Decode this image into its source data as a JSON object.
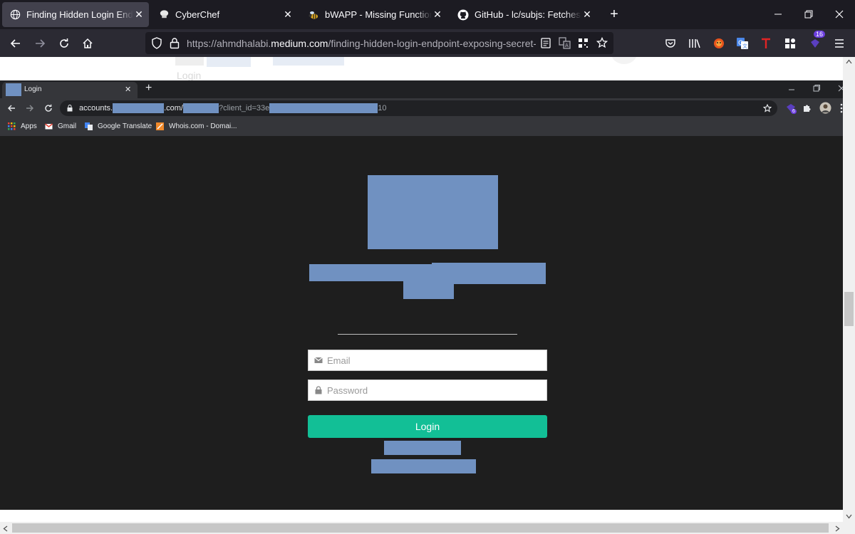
{
  "firefox": {
    "tabs": [
      {
        "title": "Finding Hidden Login Endpoint",
        "active": true,
        "icon": "globe-icon"
      },
      {
        "title": "CyberChef",
        "active": false,
        "icon": "chef-hat-icon"
      },
      {
        "title": "bWAPP - Missing Functional Lev",
        "active": false,
        "icon": "bee-icon"
      },
      {
        "title": "GitHub - lc/subjs: Fetches javasc",
        "active": false,
        "icon": "github-icon"
      }
    ],
    "new_tab": "+",
    "url": {
      "prefix": "https://ahmdhalabi.",
      "domain": "medium.com",
      "path": "/finding-hidden-login-endpoint-exposing-secret-clie"
    },
    "toolbar_badge": "16"
  },
  "background_page": {
    "title_fragment": "Login"
  },
  "chrome": {
    "tab_title": "Login",
    "new_tab": "+",
    "url": {
      "part1": "accounts.",
      "part2": ".com/",
      "part3": "?client_id=33e",
      "part4": "10"
    },
    "extension_badge": "6",
    "bookmarks": [
      {
        "label": "Apps",
        "icon": "apps-grid-icon"
      },
      {
        "label": "Gmail",
        "icon": "gmail-icon"
      },
      {
        "label": "Google Translate",
        "icon": "google-translate-icon"
      },
      {
        "label": "Whois.com - Domai...",
        "icon": "whois-icon"
      }
    ]
  },
  "login_form": {
    "email_placeholder": "Email",
    "password_placeholder": "Password",
    "login_label": "Login"
  },
  "colors": {
    "redaction": "#7091c1",
    "login_button": "#12bf96",
    "firefox_bg": "#1c1b22"
  }
}
